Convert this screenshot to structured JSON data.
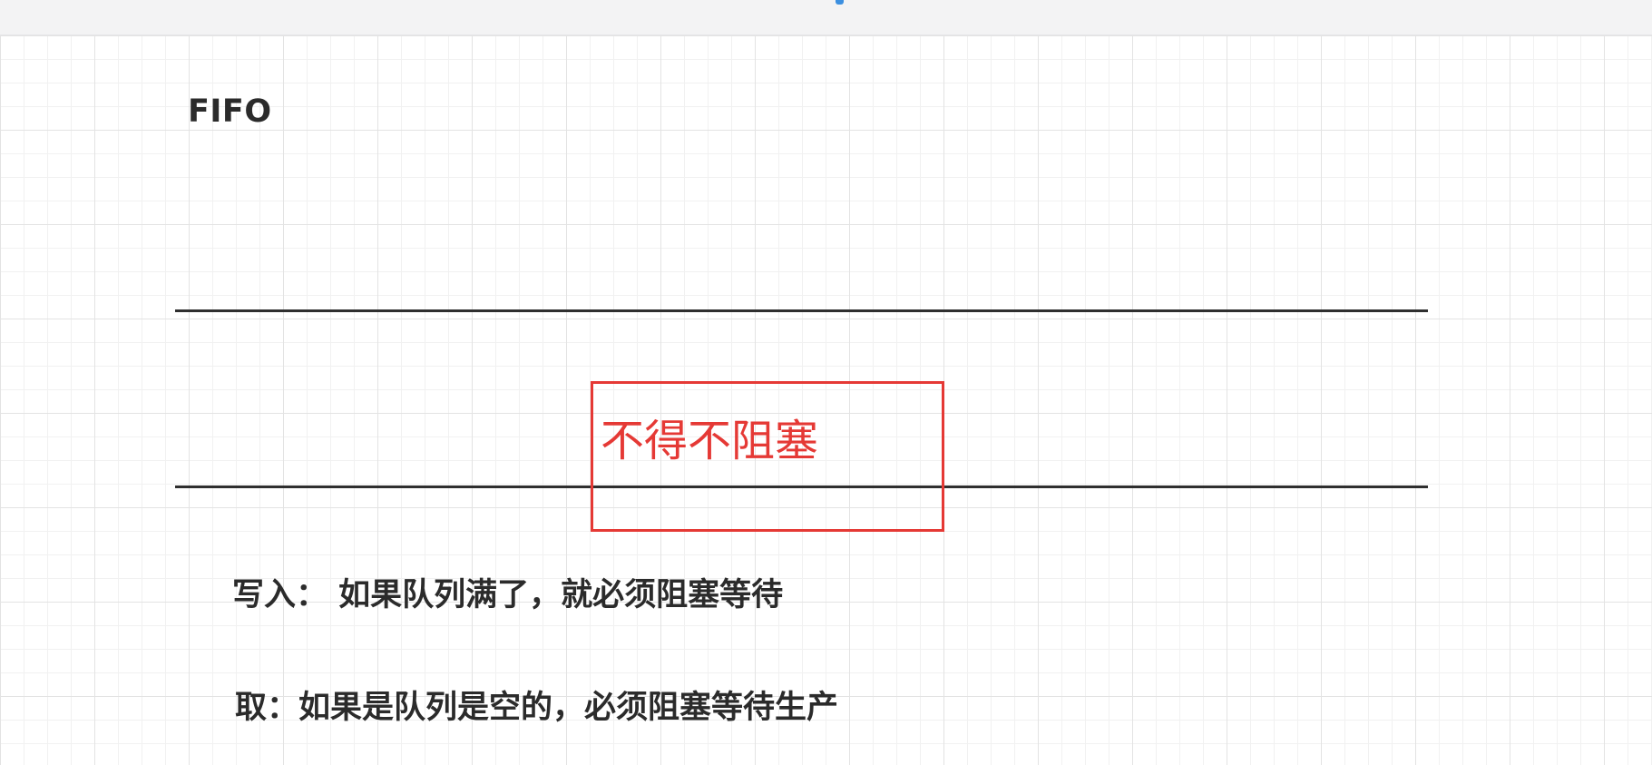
{
  "diagram": {
    "title": "FIFO",
    "highlight_label": "不得不阻塞",
    "rules": {
      "write": "写入：  如果队列满了，就必须阻塞等待",
      "take": "取：如果是队列是空的，必须阻塞等待生产"
    }
  },
  "colors": {
    "highlight": "#e53935",
    "line": "#2f2f2f",
    "text": "#2b2b2b"
  }
}
